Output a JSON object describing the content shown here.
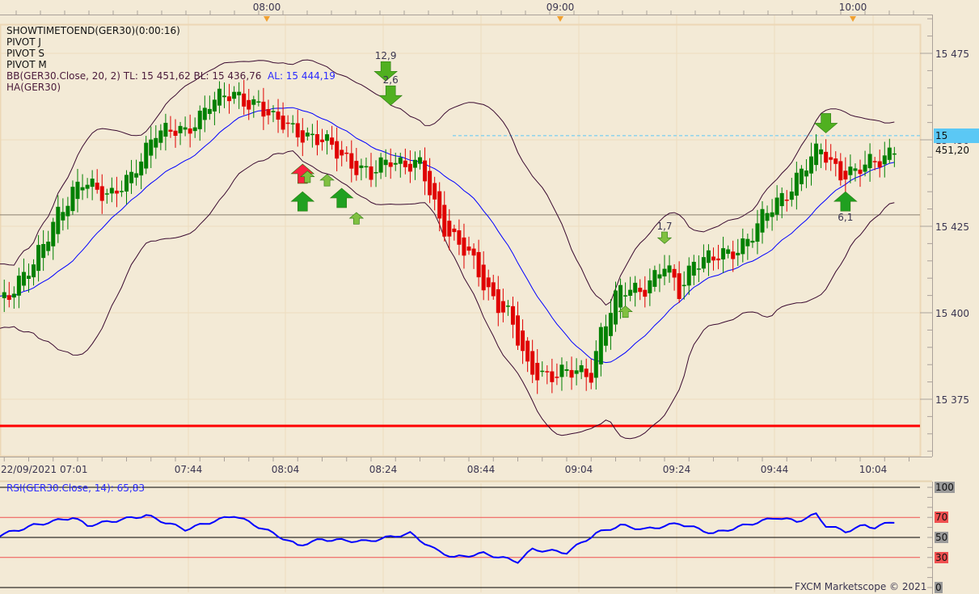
{
  "legend": {
    "timer": "SHOWTIMETOEND(GER30)(0:00:16)",
    "pivot_j": "PIVOT J",
    "pivot_s": "PIVOT S",
    "pivot_m": "PIVOT M",
    "bb": "BB(GER30.Close, 20, 2)  TL: 15 451,62  BL: 15 436,76",
    "bb_al": "AL: 15 444,19",
    "ha": "HA(GER30)"
  },
  "current_price_label": "15 451,20",
  "rsi": {
    "title": "RSI(GER30.Close, 14): 65,83",
    "levels": [
      {
        "label": "100",
        "value": 100,
        "style": "g"
      },
      {
        "label": "70",
        "value": 70,
        "style": "r"
      },
      {
        "label": "50",
        "value": 50,
        "style": "g"
      },
      {
        "label": "30",
        "value": 30,
        "style": "r"
      },
      {
        "label": "0",
        "value": 0,
        "style": "g"
      }
    ]
  },
  "credit": "FXCM Marketscope © 2021",
  "colors": {
    "up": "#008000",
    "down": "#e00000",
    "sma": "#0000ff",
    "bands": "#3a0a30",
    "rsi": "#0000ff",
    "support": "#ff0000",
    "current": "#5bc8f5"
  },
  "chart_data": {
    "type": "candlestick",
    "symbol": "GER30",
    "timeframe_minutes": 1,
    "start_time": "07:01",
    "top_axis_labels": [
      "08:00",
      "09:00",
      "10:00"
    ],
    "bottom_axis_labels": [
      "22/09/2021 07:01",
      "07:44",
      "08:04",
      "08:24",
      "08:44",
      "09:04",
      "09:24",
      "09:44",
      "10:04"
    ],
    "price_ticks": [
      {
        "value": 15475,
        "label": "15 475"
      },
      {
        "value": 15450,
        "label": "15 450"
      },
      {
        "value": 15425,
        "label": "15 425"
      },
      {
        "value": 15400,
        "label": "15 400"
      },
      {
        "value": 15375,
        "label": "15 375"
      }
    ],
    "ylim": [
      15360,
      15490
    ],
    "close_path": [
      [
        4,
        15404
      ],
      [
        11,
        15413
      ],
      [
        16,
        15430
      ],
      [
        21,
        15437
      ],
      [
        27,
        15435
      ],
      [
        31,
        15438
      ],
      [
        36,
        15454
      ],
      [
        42,
        15451
      ],
      [
        47,
        15462
      ],
      [
        52,
        15462
      ],
      [
        57,
        15461
      ],
      [
        60,
        15455
      ],
      [
        65,
        15453
      ],
      [
        70,
        15449
      ],
      [
        75,
        15445
      ],
      [
        80,
        15439
      ],
      [
        84,
        15445
      ],
      [
        90,
        15442
      ],
      [
        94,
        15427
      ],
      [
        97,
        15422
      ],
      [
        100,
        15416
      ],
      [
        103,
        15408
      ],
      [
        108,
        15400
      ],
      [
        112,
        15383
      ],
      [
        115,
        15383
      ],
      [
        120,
        15382
      ],
      [
        125,
        15383
      ],
      [
        127,
        15395
      ],
      [
        131,
        15406
      ],
      [
        136,
        15408
      ],
      [
        140,
        15413
      ],
      [
        143,
        15406
      ],
      [
        146,
        15416
      ],
      [
        150,
        15415
      ],
      [
        153,
        15417
      ],
      [
        158,
        15423
      ],
      [
        163,
        15432
      ],
      [
        168,
        15441
      ],
      [
        172,
        15447
      ],
      [
        176,
        15441
      ],
      [
        179,
        15440
      ],
      [
        187,
        15448
      ]
    ],
    "rsi_path": [
      [
        4,
        52
      ],
      [
        11,
        62
      ],
      [
        19,
        70
      ],
      [
        22,
        62
      ],
      [
        34,
        72
      ],
      [
        42,
        58
      ],
      [
        52,
        72
      ],
      [
        60,
        54
      ],
      [
        65,
        42
      ],
      [
        70,
        48
      ],
      [
        79,
        46
      ],
      [
        88,
        54
      ],
      [
        93,
        38
      ],
      [
        97,
        30
      ],
      [
        103,
        34
      ],
      [
        110,
        26
      ],
      [
        113,
        38
      ],
      [
        120,
        35
      ],
      [
        126,
        54
      ],
      [
        131,
        62
      ],
      [
        136,
        58
      ],
      [
        143,
        64
      ],
      [
        150,
        54
      ],
      [
        158,
        64
      ],
      [
        163,
        70
      ],
      [
        167,
        66
      ],
      [
        171,
        73
      ],
      [
        173,
        62
      ],
      [
        177,
        56
      ],
      [
        181,
        62
      ],
      [
        183,
        60
      ],
      [
        187,
        66
      ]
    ],
    "bollinger": {
      "period": 20,
      "deviations": 2,
      "TL": 15451.62,
      "BL": 15436.76,
      "AL": 15444.19
    },
    "horizontal_lines": [
      {
        "name": "support-line",
        "price": 15367.3,
        "color": "#ff0000"
      },
      {
        "name": "pivot-line",
        "price": 15428.3,
        "color": "#8a8070"
      },
      {
        "name": "current-price-line",
        "price": 15451.2,
        "color": "#5bc8f5"
      }
    ],
    "current_price": 15451.2,
    "markers": [
      {
        "minute": 66,
        "price": 15443,
        "dir": "up",
        "size": "big",
        "color": "#ff2040",
        "label": ""
      },
      {
        "minute": 66,
        "price": 15435,
        "dir": "up",
        "size": "big",
        "color": "#20a020",
        "label": ""
      },
      {
        "minute": 67,
        "price": 15441,
        "dir": "up",
        "size": "small",
        "color": "#80c040",
        "label": ""
      },
      {
        "minute": 71,
        "price": 15440,
        "dir": "up",
        "size": "small",
        "color": "#80c040",
        "label": ""
      },
      {
        "minute": 74,
        "price": 15436,
        "dir": "up",
        "size": "big",
        "color": "#20a020",
        "label": ""
      },
      {
        "minute": 77,
        "price": 15429,
        "dir": "up",
        "size": "small",
        "color": "#80c040",
        "label": ""
      },
      {
        "minute": 83,
        "price": 15467,
        "dir": "down",
        "size": "big",
        "color": "#50b020",
        "label": "12,9"
      },
      {
        "minute": 84,
        "price": 15460,
        "dir": "down",
        "size": "big",
        "color": "#50b020",
        "label": "2,6"
      },
      {
        "minute": 140,
        "price": 15420,
        "dir": "down",
        "size": "small",
        "color": "#80c040",
        "label": "1,7"
      },
      {
        "minute": 132,
        "price": 15402,
        "dir": "up",
        "size": "small",
        "color": "#80c040",
        "label": ""
      },
      {
        "minute": 173,
        "price": 15452,
        "dir": "down",
        "size": "big",
        "color": "#50b020",
        "label": ""
      },
      {
        "minute": 177,
        "price": 15435,
        "dir": "up",
        "size": "big",
        "color": "#20a020",
        "label": "6,1"
      }
    ]
  }
}
